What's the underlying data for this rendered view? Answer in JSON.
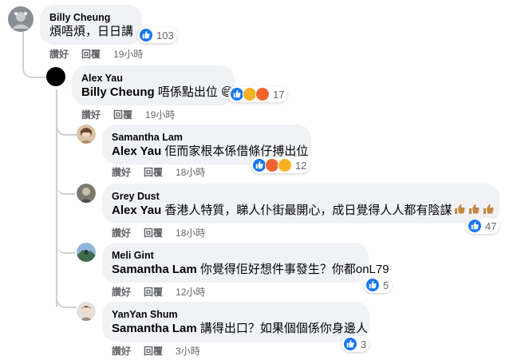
{
  "comments": [
    {
      "author": "Billy Cheung",
      "mention": "",
      "text": "煩唔煩，日日講",
      "reactions": "103",
      "like_label": "讚好",
      "reply_label": "回覆",
      "time": "19小時"
    },
    {
      "author": "Alex Yau",
      "mention": "Billy Cheung",
      "text": " 唔係點出位",
      "reactions": "17",
      "like_label": "讚好",
      "reply_label": "回覆",
      "time": "19小時"
    },
    {
      "author": "Samantha Lam",
      "mention": "Alex Yau",
      "text": " 佢而家根本係借條仔搏出位",
      "reactions": "12",
      "like_label": "讚好",
      "reply_label": "回覆",
      "time": "18小時"
    },
    {
      "author": "Grey Dust",
      "mention": "Alex Yau",
      "text": " 香港人特質，睇人仆街最開心，成日覺得人人都有陰謀",
      "reactions": "47",
      "like_label": "讚好",
      "reply_label": "回覆",
      "time": "18小時"
    },
    {
      "author": "Meli Gint",
      "mention": "Samantha Lam",
      "text": " 你覺得佢好想件事發生？你都onL79",
      "reactions": "5",
      "like_label": "讚好",
      "reply_label": "回覆",
      "time": "12小時"
    },
    {
      "author": "YanYan Shum",
      "mention": "Samantha Lam",
      "text": " 講得出口？如果個個係你身邊人",
      "reactions": "3",
      "like_label": "讚好",
      "reply_label": "回覆",
      "time": "3小時"
    }
  ],
  "colors": {
    "bubble": "#f0f2f5",
    "meta": "#65676b",
    "like": "#1877f2",
    "angry": "#f0652d",
    "haha": "#f7b125",
    "thread_line": "#ced0d4"
  },
  "icons": [
    "like-icon",
    "angry-icon",
    "haha-icon",
    "wow-icon",
    "smile-emoji-icon",
    "thumbs-up-emoji-icon"
  ]
}
